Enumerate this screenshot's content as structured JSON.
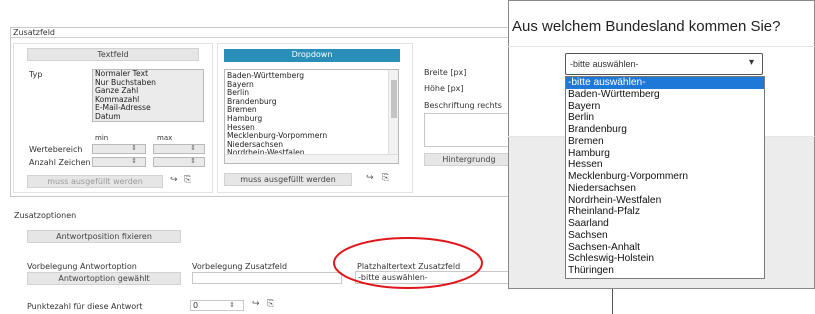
{
  "editor": {
    "section_zusatzfeld": "Zusatzfeld",
    "textfeld_button": "Textfeld",
    "typ_label": "Typ",
    "typ_options": [
      "Normaler Text",
      "Nur Buchstaben",
      "Ganze Zahl",
      "Kommazahl",
      "E-Mail-Adresse",
      "Datum"
    ],
    "min_label": "min",
    "max_label": "max",
    "wertebereich_label": "Wertebereich",
    "anzahl_zeichen_label": "Anzahl Zeichen",
    "muss_ausgefuellt_left": "muss ausgefüllt werden",
    "dropdown_button": "Dropdown",
    "dropdown_options": [
      "Baden-Württemberg",
      "Bayern",
      "Berlin",
      "Brandenburg",
      "Bremen",
      "Hamburg",
      "Hessen",
      "Mecklenburg-Vorpommern",
      "Niedersachsen",
      "Nordrhein-Westfalen"
    ],
    "muss_ausgefuellt_mid": "muss ausgefüllt werden",
    "breite_label": "Breite [px]",
    "hoehe_label": "Höhe [px]",
    "beschriftung_label": "Beschriftung rechts",
    "hintergrund_button": "Hintergrundg",
    "section_zusatzoptionen": "Zusatzoptionen",
    "antwortposition_button": "Antwortposition fixieren",
    "vorbelegung_antwortoption_label": "Vorbelegung Antwortoption",
    "antwortoption_gewaehlt_button": "Antwortoption gewählt",
    "vorbelegung_zusatzfeld_label": "Vorbelegung Zusatzfeld",
    "platzhaltertext_label": "Platzhaltertext Zusatzfeld",
    "platzhaltertext_value": "-bitte auswählen-",
    "punktezahl_label": "Punktezahl für diese Antwort",
    "punktezahl_value": "0"
  },
  "popup": {
    "question": "Aus welchem Bundesland kommen Sie?",
    "select_value": "-bitte auswählen-",
    "options": [
      "-bitte auswählen-",
      "Baden-Württemberg",
      "Bayern",
      "Berlin",
      "Brandenburg",
      "Bremen",
      "Hamburg",
      "Hessen",
      "Mecklenburg-Vorpommern",
      "Niedersachsen",
      "Nordrhein-Westfalen",
      "Rheinland-Pfalz",
      "Saarland",
      "Sachsen",
      "Sachsen-Anhalt",
      "Schleswig-Holstein",
      "Thüringen"
    ],
    "selected_index": 0
  },
  "icons": {
    "arrow_icon": "↪",
    "copy_icon": "⎘",
    "spinner_icon": "⇕",
    "chevron_down": "▾"
  },
  "colors": {
    "accent_blue": "#2a8fb8",
    "selection_blue": "#1e78d7",
    "highlight_red": "#e0161b"
  }
}
